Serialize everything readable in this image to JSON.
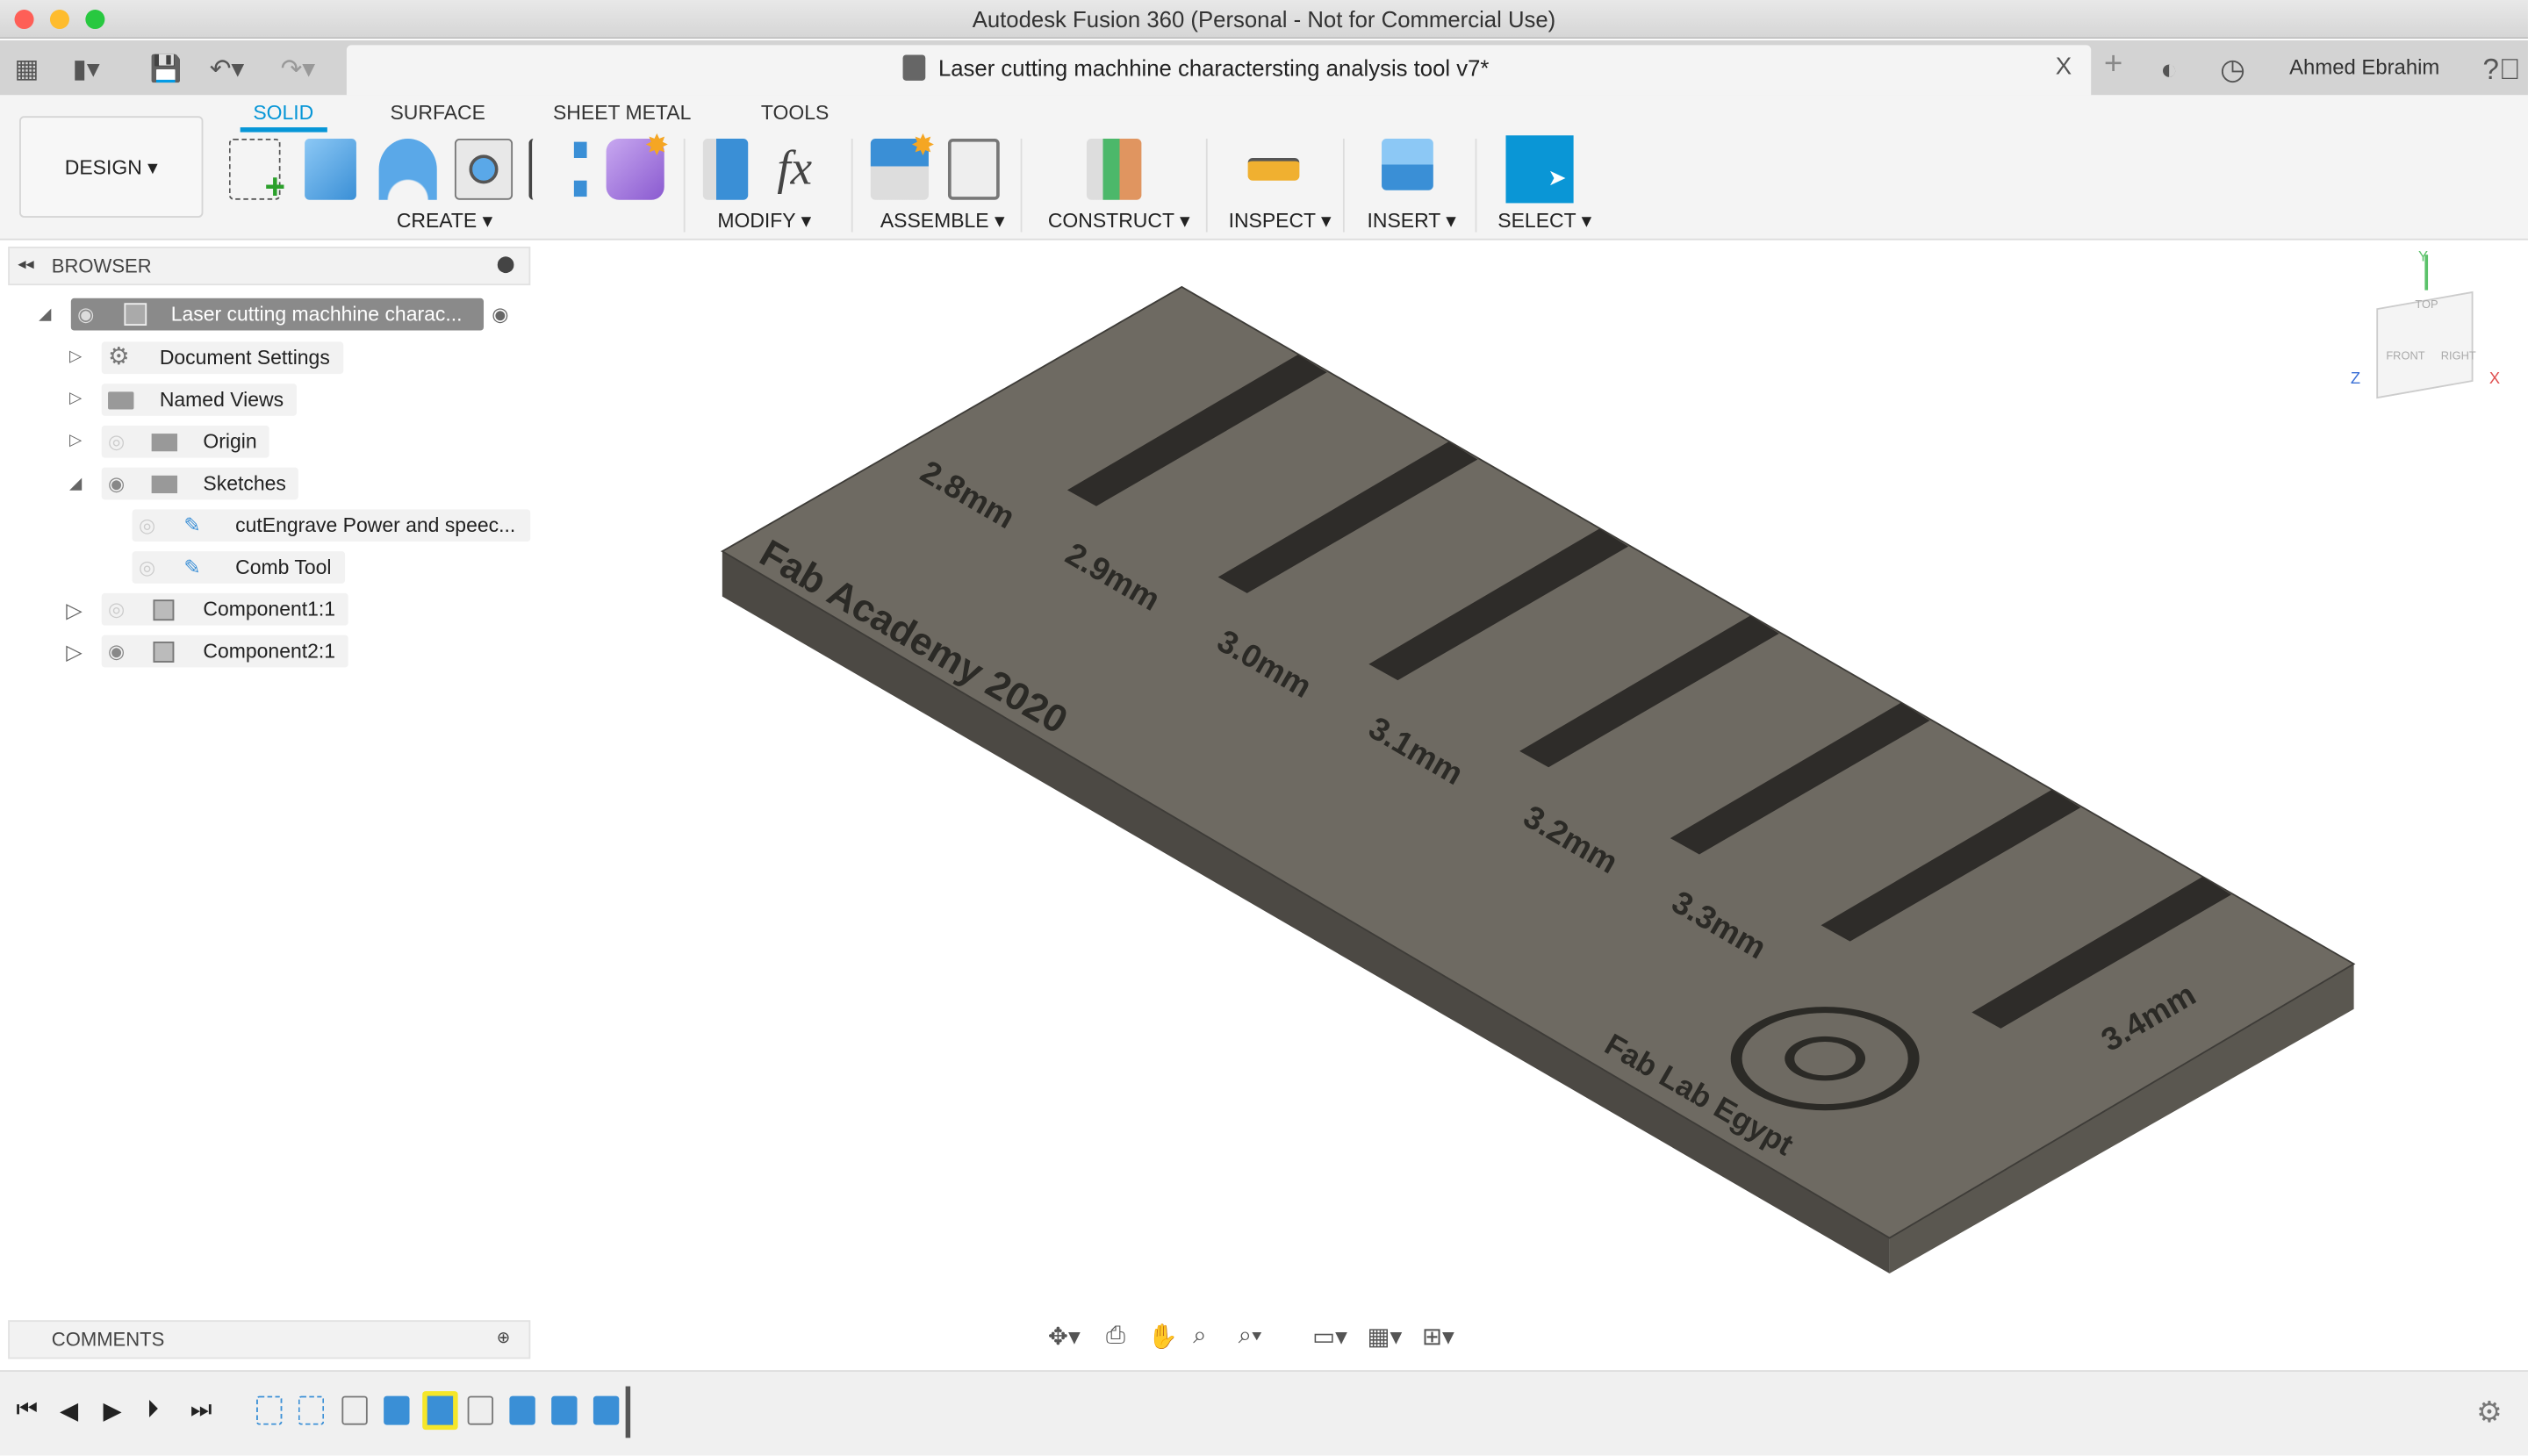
{
  "window": {
    "title": "Autodesk Fusion 360 (Personal - Not for Commercial Use)"
  },
  "document_tab": {
    "title": "Laser cutting machhine charactersting analysis tool v7*",
    "close": "X"
  },
  "user": {
    "name": "Ahmed Ebrahim"
  },
  "workspace": {
    "label": "DESIGN ▾"
  },
  "tabs": [
    {
      "label": "SOLID",
      "active": true
    },
    {
      "label": "SURFACE"
    },
    {
      "label": "SHEET METAL"
    },
    {
      "label": "TOOLS"
    }
  ],
  "groups": {
    "create": "CREATE ▾",
    "modify": "MODIFY ▾",
    "assemble": "ASSEMBLE ▾",
    "construct": "CONSTRUCT ▾",
    "inspect": "INSPECT ▾",
    "insert": "INSERT ▾",
    "select": "SELECT ▾"
  },
  "browser": {
    "title": "BROWSER",
    "items": [
      {
        "label": "Laser cutting machhine charac..."
      },
      {
        "label": "Document Settings"
      },
      {
        "label": "Named Views"
      },
      {
        "label": "Origin"
      },
      {
        "label": "Sketches"
      },
      {
        "label": "cutEngrave Power and speec..."
      },
      {
        "label": "Comb Tool"
      },
      {
        "label": "Component1:1"
      },
      {
        "label": "Component2:1"
      }
    ]
  },
  "comments": {
    "title": "COMMENTS"
  },
  "model": {
    "slot_labels": [
      "2.8mm",
      "2.9mm",
      "3.0mm",
      "3.1mm",
      "3.2mm",
      "3.3mm",
      "3.4mm"
    ],
    "engraving_1": "Fab Academy 2020",
    "engraving_2": "Fab Lab Egypt"
  },
  "viewcube": {
    "faces": [
      "TOP",
      "FRONT",
      "RIGHT"
    ],
    "axes": [
      "Y",
      "Z",
      "X"
    ]
  },
  "colors": {
    "accent": "#0696d7",
    "model_top": "#6e6a62",
    "model_side": "#4c4944"
  }
}
